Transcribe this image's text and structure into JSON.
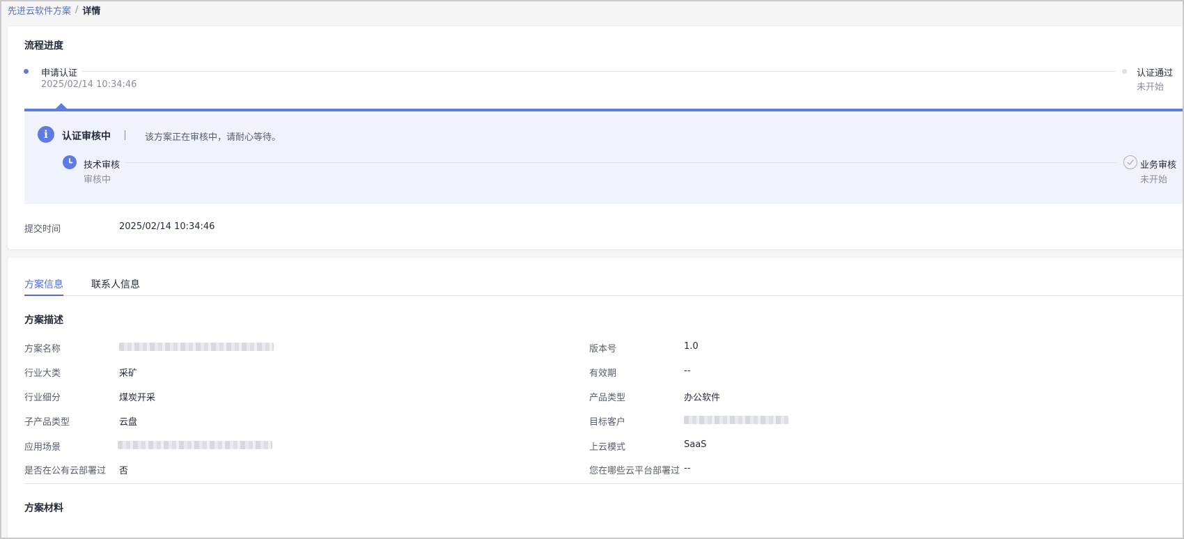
{
  "breadcrumb": {
    "parent": "先进云软件方案",
    "separator": "/",
    "current": "详情"
  },
  "process": {
    "title": "流程进度",
    "steps": [
      {
        "label": "申请认证",
        "sub": "2025/02/14 10:34:46",
        "state": "active"
      },
      {
        "label": "认证通过",
        "sub": "未开始",
        "state": "pending"
      }
    ]
  },
  "status_panel": {
    "icon": "info-icon",
    "title": "认证审核中",
    "message": "该方案正在审核中，请耐心等待。",
    "accent": "#5e7ce0",
    "background": "#f0f3fb",
    "sub_steps": [
      {
        "label": "技术审核",
        "sub": "审核中",
        "icon": "clock-icon"
      },
      {
        "label": "业务审核",
        "sub": "未开始",
        "icon": "check-circle-icon"
      }
    ]
  },
  "submit": {
    "label": "提交时间",
    "value": "2025/02/14 10:34:46"
  },
  "tabs": [
    {
      "label": "方案信息",
      "active": true
    },
    {
      "label": "联系人信息",
      "active": false
    }
  ],
  "description": {
    "title": "方案描述",
    "left": [
      {
        "label": "方案名称",
        "value": "",
        "blurred": true
      },
      {
        "label": "行业大类",
        "value": "采矿"
      },
      {
        "label": "行业细分",
        "value": "煤炭开采"
      },
      {
        "label": "子产品类型",
        "value": "云盘"
      },
      {
        "label": "应用场景",
        "value": "",
        "blurred": true
      },
      {
        "label": "是否在公有云部署过",
        "value": "否"
      }
    ],
    "right": [
      {
        "label": "版本号",
        "value": "1.0"
      },
      {
        "label": "有效期",
        "value": "--"
      },
      {
        "label": "产品类型",
        "value": "办公软件"
      },
      {
        "label": "目标客户",
        "value": "",
        "blurred": true
      },
      {
        "label": "上云模式",
        "value": "SaaS"
      },
      {
        "label": "您在哪些云平台部署过",
        "value": "--"
      }
    ]
  },
  "materials": {
    "title": "方案材料"
  },
  "colors": {
    "brand": "#526ecc",
    "primary_text": "#252b3a",
    "secondary_text": "#8a8e99"
  }
}
